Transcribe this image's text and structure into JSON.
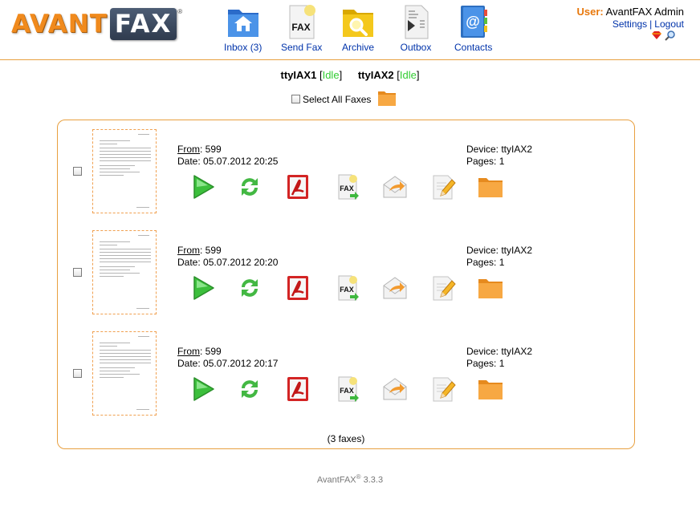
{
  "header": {
    "logo": {
      "avant": "AVANT",
      "fax": "FAX",
      "reg": "®"
    },
    "nav": [
      {
        "label": "Inbox (3)",
        "icon": "inbox-house-folder-icon"
      },
      {
        "label": "Send Fax",
        "icon": "send-fax-icon",
        "glyph": "FAX"
      },
      {
        "label": "Archive",
        "icon": "archive-search-folder-icon"
      },
      {
        "label": "Outbox",
        "icon": "outbox-icon"
      },
      {
        "label": "Contacts",
        "icon": "contacts-addressbook-icon",
        "glyph": "@"
      }
    ],
    "user": {
      "prefix": "User:",
      "name": "AvantFAX Admin",
      "settings": "Settings",
      "separator": "|",
      "logout": "Logout"
    }
  },
  "modems": [
    {
      "name": "ttyIAX1",
      "open": "[",
      "status": "Idle",
      "close": "]"
    },
    {
      "name": "ttyIAX2",
      "open": "[",
      "status": "Idle",
      "close": "]"
    }
  ],
  "select_all": {
    "label": "Select All Faxes"
  },
  "faxes": [
    {
      "from_label": "From",
      "from": ": 599",
      "date": "Date: 05.07.2012 20:25",
      "device": "Device: ttyIAX2",
      "pages": "Pages: 1"
    },
    {
      "from_label": "From",
      "from": ": 599",
      "date": "Date: 05.07.2012 20:20",
      "device": "Device: ttyIAX2",
      "pages": "Pages: 1"
    },
    {
      "from_label": "From",
      "from": ": 599",
      "date": "Date: 05.07.2012 20:17",
      "device": "Device: ttyIAX2",
      "pages": "Pages: 1"
    }
  ],
  "row_actions": [
    {
      "icon": "view-play-icon"
    },
    {
      "icon": "rotate-refresh-icon"
    },
    {
      "icon": "pdf-icon"
    },
    {
      "icon": "fax-forward-icon",
      "glyph": "FAX"
    },
    {
      "icon": "email-forward-icon"
    },
    {
      "icon": "edit-pencil-icon"
    },
    {
      "icon": "archive-folder-icon"
    }
  ],
  "summary": "(3 faxes)",
  "footer": {
    "product": "AvantFAX",
    "reg": "®",
    "version": " 3.3.3"
  },
  "colors": {
    "accent": "#e8780c",
    "link": "#0033aa",
    "idle": "#33cc33",
    "border": "#e8a040"
  }
}
